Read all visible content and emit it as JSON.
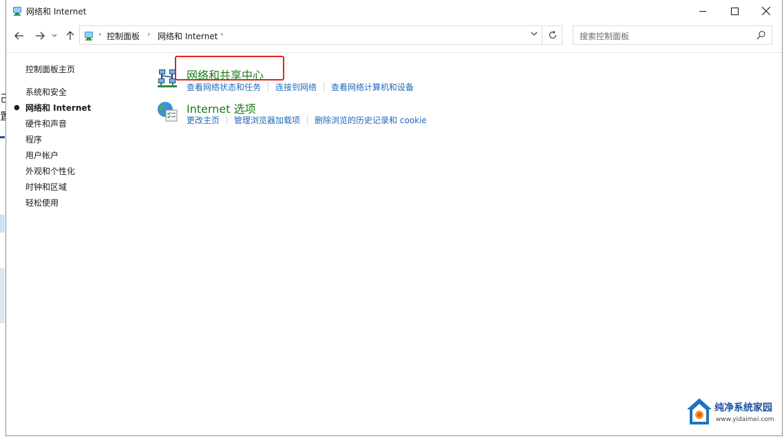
{
  "window": {
    "title": "网络和 Internet",
    "buttons": {
      "minimize": "minimize",
      "maximize": "maximize",
      "close": "close"
    }
  },
  "nav": {
    "breadcrumb": [
      "控制面板",
      "网络和 Internet"
    ],
    "search_placeholder": "搜索控制面板"
  },
  "sidebar": {
    "items": [
      {
        "label": "控制面板主页",
        "current": false
      },
      {
        "label": "系统和安全",
        "current": false
      },
      {
        "label": "网络和 Internet",
        "current": true
      },
      {
        "label": "硬件和声音",
        "current": false
      },
      {
        "label": "程序",
        "current": false
      },
      {
        "label": "用户帐户",
        "current": false
      },
      {
        "label": "外观和个性化",
        "current": false
      },
      {
        "label": "时钟和区域",
        "current": false
      },
      {
        "label": "轻松使用",
        "current": false
      }
    ]
  },
  "categories": [
    {
      "title": "网络和共享中心",
      "icon": "network-sharing-icon",
      "links": [
        "查看网络状态和任务",
        "连接到网络",
        "查看网络计算机和设备"
      ]
    },
    {
      "title": "Internet 选项",
      "icon": "internet-options-icon",
      "links": [
        "更改主页",
        "管理浏览器加载项",
        "删除浏览的历史记录和 cookie"
      ]
    }
  ],
  "watermark": {
    "text": "纯净系统家园",
    "url": "www.yidaimei.com"
  },
  "background_fragments": [
    "己",
    "置"
  ],
  "colors": {
    "link": "#1f6ab8",
    "category_title": "#1a7a1a",
    "highlight": "#e0201c"
  }
}
